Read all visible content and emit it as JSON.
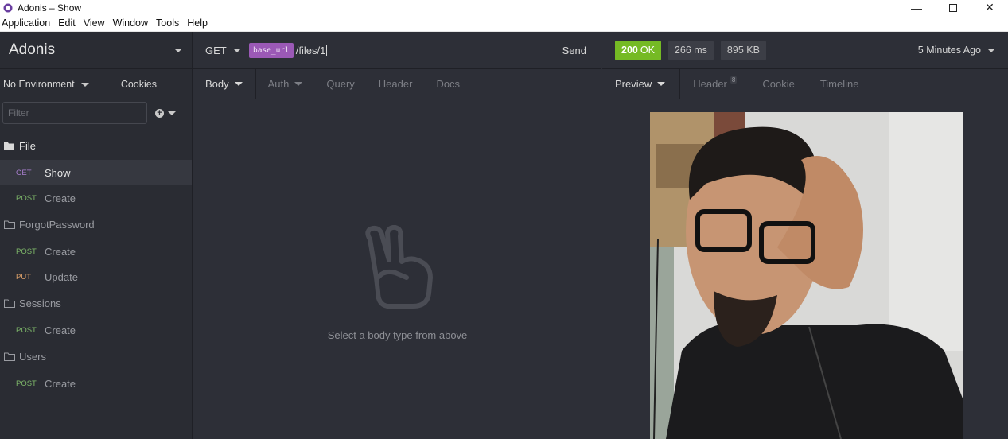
{
  "window": {
    "title": "Adonis – Show"
  },
  "menu": [
    "Application",
    "Edit",
    "View",
    "Window",
    "Tools",
    "Help"
  ],
  "sidebar": {
    "workspace": "Adonis",
    "environment": "No Environment",
    "cookies": "Cookies",
    "filter_placeholder": "Filter",
    "folders": [
      {
        "name": "File",
        "open": true,
        "requests": [
          {
            "method": "GET",
            "name": "Show",
            "active": true
          },
          {
            "method": "POST",
            "name": "Create"
          }
        ]
      },
      {
        "name": "ForgotPassword",
        "open": false,
        "requests": [
          {
            "method": "POST",
            "name": "Create"
          },
          {
            "method": "PUT",
            "name": "Update"
          }
        ]
      },
      {
        "name": "Sessions",
        "open": false,
        "requests": [
          {
            "method": "POST",
            "name": "Create"
          }
        ]
      },
      {
        "name": "Users",
        "open": false,
        "requests": [
          {
            "method": "POST",
            "name": "Create"
          }
        ]
      }
    ]
  },
  "request": {
    "method": "GET",
    "url_tag": "base_url",
    "url_path": "/files/1",
    "send": "Send",
    "tabs": [
      "Body",
      "Auth",
      "Query",
      "Header",
      "Docs"
    ],
    "empty_text": "Select a body type from above"
  },
  "response": {
    "status_code": "200",
    "status_text": "OK",
    "time": "266 ms",
    "size": "895 KB",
    "time_ago": "5 Minutes Ago",
    "tabs": [
      "Preview",
      "Header",
      "Cookie",
      "Timeline"
    ],
    "header_count": "8"
  },
  "colors": {
    "accent": "#9b59b6",
    "status_ok": "#75ba24",
    "post": "#7eb86a",
    "get": "#a97fcf",
    "put": "#e0a26a"
  }
}
